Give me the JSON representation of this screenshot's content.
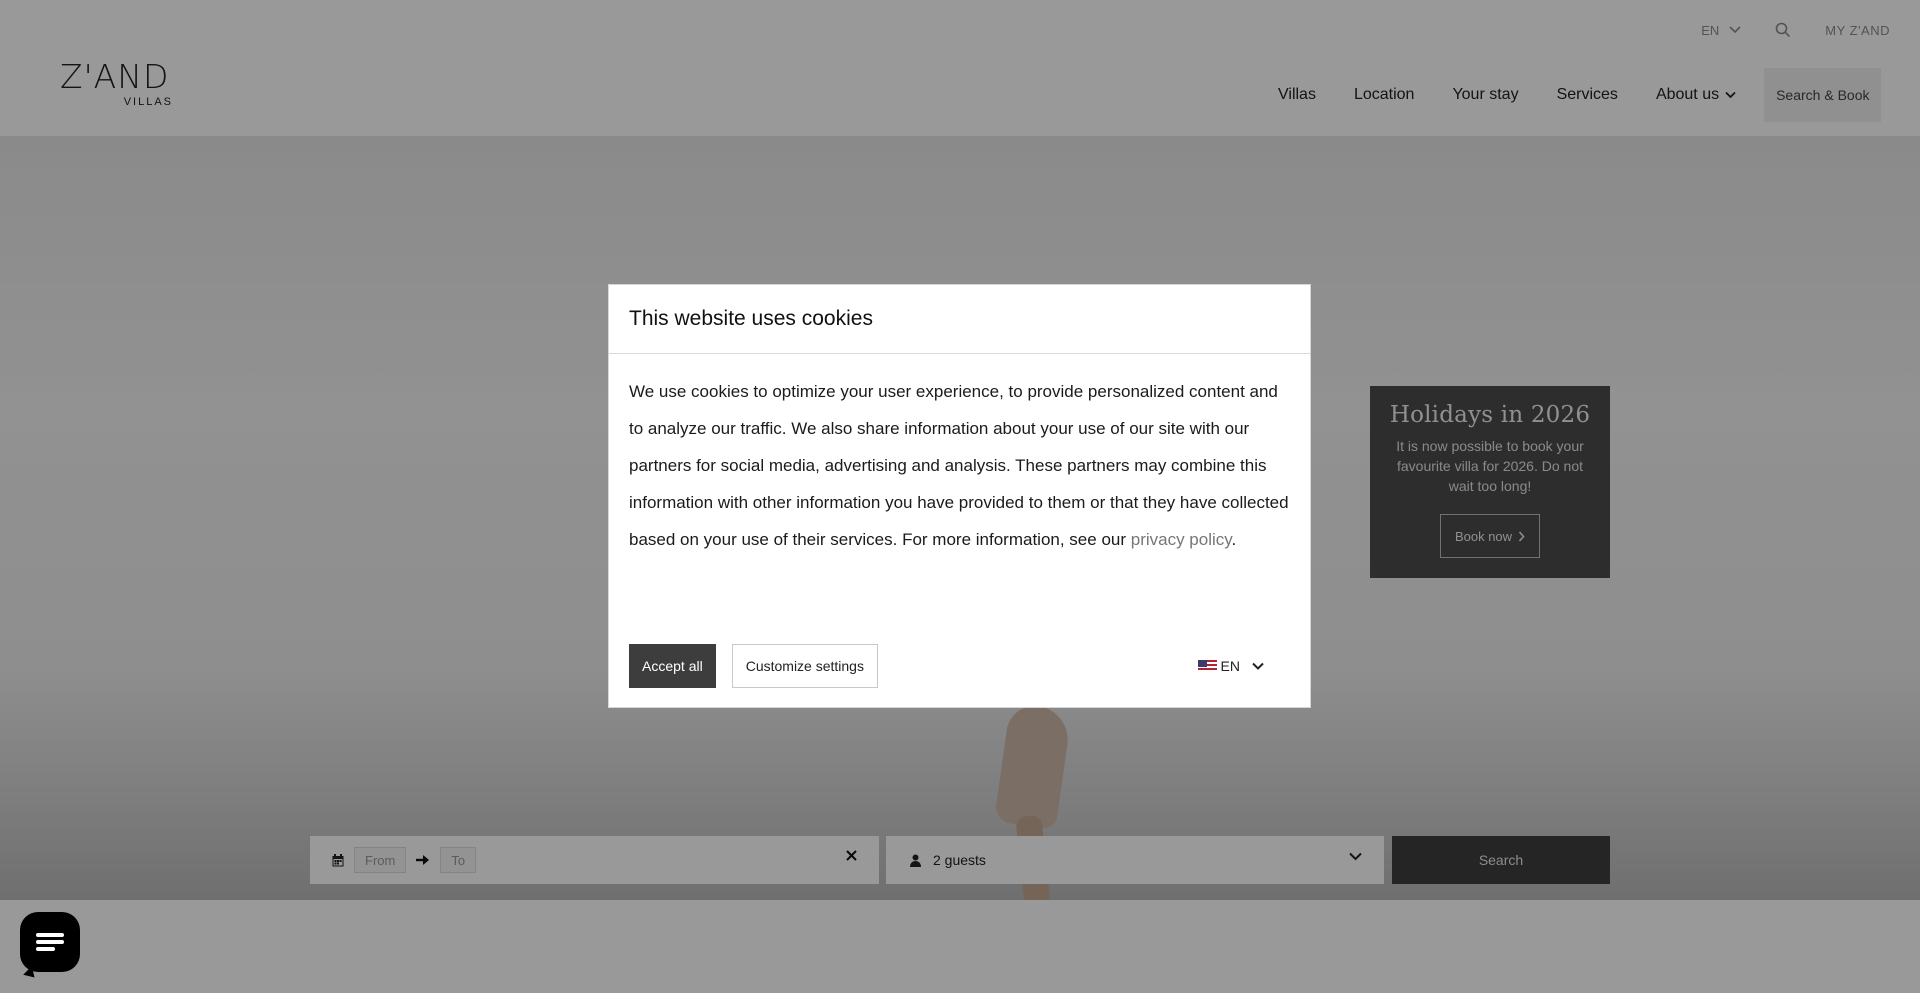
{
  "brand": {
    "logo_text": "Z'AND",
    "logo_sub": "VILLAS"
  },
  "topbar": {
    "language": "EN",
    "my_account": "MY Z'AND"
  },
  "nav": {
    "items": [
      "Villas",
      "Location",
      "Your stay",
      "Services",
      "About us"
    ],
    "book_label": "Search & Book"
  },
  "promo": {
    "title": "Holidays in 2026",
    "text": "It is now possible to book your favourite villa for 2026. Do not wait too long!",
    "button": "Book now"
  },
  "search": {
    "from_placeholder": "From",
    "to_placeholder": "To",
    "guests": "2 guests",
    "button": "Search"
  },
  "cookie": {
    "title": "This website uses cookies",
    "body": "We use cookies to optimize your user experience, to provide personalized content and to analyze our traffic. We also share information about your use of our site with our partners for social media, advertising and analysis. These partners may combine this information with other information you have provided to them or that they have collected based on your use of their services. For more information, see our ",
    "link": "privacy policy",
    "after_link": ".",
    "accept": "Accept all",
    "customize": "Customize settings",
    "language": "EN"
  },
  "icons": {
    "search": "search-icon",
    "chevron": "chevron-down-icon",
    "calendar": "calendar-icon",
    "arrow": "arrow-right-icon",
    "close": "close-icon",
    "user": "user-icon",
    "chat": "chat-icon",
    "flag": "us-flag-icon"
  },
  "colors": {
    "overlay": "#000000",
    "promo_bg": "#4b4b4b",
    "accept_bg": "#3d3d3d",
    "search_bg": "#3f3f3f"
  }
}
